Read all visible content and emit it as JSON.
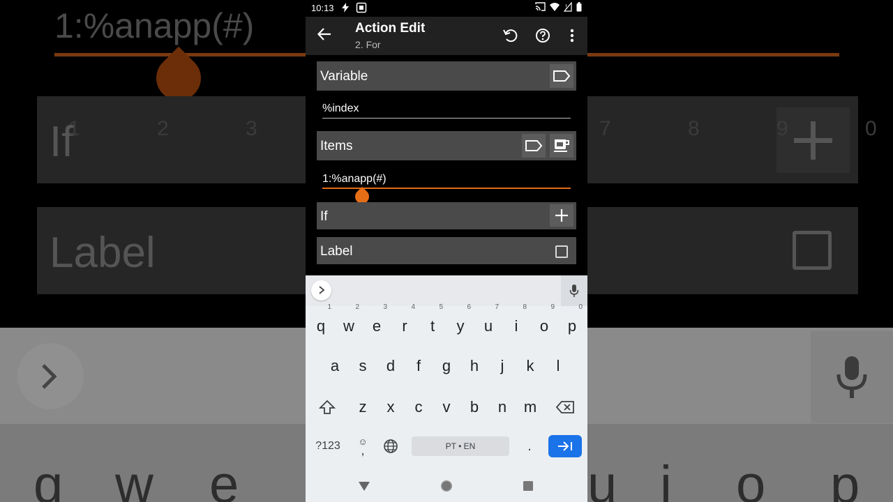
{
  "background": {
    "items_value": "1:%anapp(#)",
    "if_label": "If",
    "label_label": "Label",
    "number_hints": [
      "1",
      "2",
      "3",
      "7",
      "8",
      "9",
      "0"
    ],
    "letters": [
      "q",
      "w",
      "e",
      "u",
      "i",
      "o",
      "p"
    ]
  },
  "status_bar": {
    "time": "10:13"
  },
  "app_bar": {
    "title": "Action Edit",
    "subtitle": "2. For"
  },
  "form": {
    "variable_label": "Variable",
    "variable_value": "%index",
    "items_label": "Items",
    "items_value": "1:%anapp(#)",
    "if_label": "If",
    "label_label": "Label"
  },
  "keyboard": {
    "row1": [
      {
        "key": "q",
        "hint": "1"
      },
      {
        "key": "w",
        "hint": "2"
      },
      {
        "key": "e",
        "hint": "3"
      },
      {
        "key": "r",
        "hint": "4"
      },
      {
        "key": "t",
        "hint": "5"
      },
      {
        "key": "y",
        "hint": "6"
      },
      {
        "key": "u",
        "hint": "7"
      },
      {
        "key": "i",
        "hint": "8"
      },
      {
        "key": "o",
        "hint": "9"
      },
      {
        "key": "p",
        "hint": "0"
      }
    ],
    "row2": [
      "a",
      "s",
      "d",
      "f",
      "g",
      "h",
      "j",
      "k",
      "l"
    ],
    "row3": [
      "z",
      "x",
      "c",
      "v",
      "b",
      "n",
      "m"
    ],
    "symbols_label": "?123",
    "emoji_label": "☺",
    "comma_label": ",",
    "space_label": "PT • EN",
    "period_label": "."
  },
  "colors": {
    "accent": "#e56d16",
    "enter_key": "#1a73e8"
  }
}
